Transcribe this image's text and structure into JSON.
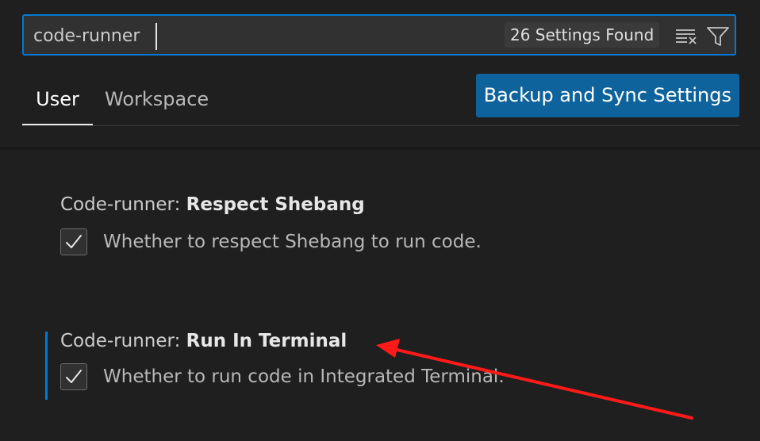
{
  "search": {
    "value": "code-runner",
    "result_count": "26 Settings Found",
    "clear_icon": "clear-filter-icon",
    "filter_icon": "filter-icon"
  },
  "tabs": [
    {
      "label": "User",
      "active": true
    },
    {
      "label": "Workspace",
      "active": false
    }
  ],
  "sync_button": {
    "label": "Backup and Sync Settings"
  },
  "settings": [
    {
      "category": "Code-runner: ",
      "label": "Respect Shebang",
      "description": "Whether to respect Shebang to run code.",
      "checked": true
    },
    {
      "category": "Code-runner: ",
      "label": "Run In Terminal",
      "description": "Whether to run code in Integrated Terminal.",
      "checked": true
    }
  ],
  "colors": {
    "background": "#1f1f1f",
    "accent": "#0078d4",
    "button": "#0e639c",
    "annotation_arrow": "#ff1a1a"
  }
}
